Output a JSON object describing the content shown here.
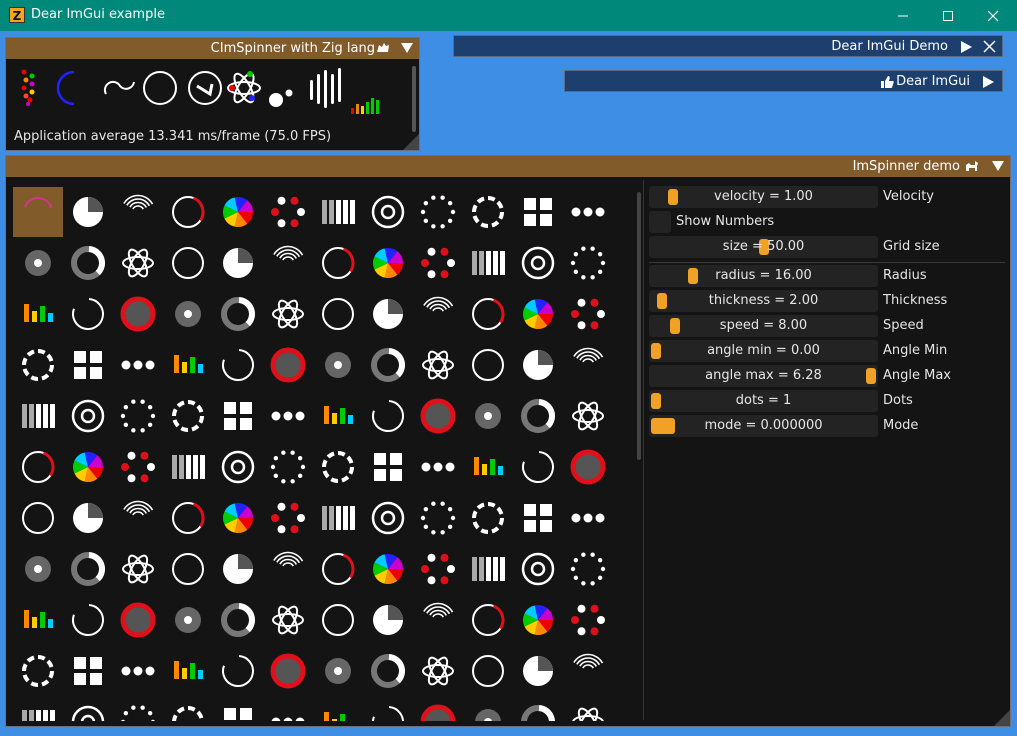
{
  "os_window": {
    "title": "Dear ImGui example",
    "app_icon_letter": "Z",
    "buttons": {
      "minimize": "—",
      "maximize": "☐",
      "close": "✕"
    }
  },
  "zig_window": {
    "title": "CImSpinner with Zig lang",
    "fps_text": "Application average 13.341 ms/frame (75.0 FPS)"
  },
  "demo_collapsed": {
    "title": "Dear ImGui Demo"
  },
  "imgui_collapsed": {
    "title": "Dear ImGui"
  },
  "spinner_window": {
    "title": "ImSpinner demo",
    "controls": [
      {
        "type": "slider",
        "value_text": "velocity = 1.00",
        "label": "Velocity",
        "grab": 0.08
      },
      {
        "type": "checkbox",
        "label": "Show Numbers",
        "checked": false
      },
      {
        "type": "slider",
        "value_text": "size = 50.00",
        "label": "Grid size",
        "grab": 0.5
      },
      {
        "type": "separator"
      },
      {
        "type": "slider",
        "value_text": "radius = 16.00",
        "label": "Radius",
        "grab": 0.17
      },
      {
        "type": "slider",
        "value_text": "thickness = 2.00",
        "label": "Thickness",
        "grab": 0.03
      },
      {
        "type": "slider",
        "value_text": "speed = 8.00",
        "label": "Speed",
        "grab": 0.09
      },
      {
        "type": "slider",
        "value_text": "angle min = 0.00",
        "label": "Angle Min",
        "grab": 0.0
      },
      {
        "type": "slider",
        "value_text": "angle max = 6.28",
        "label": "Angle Max",
        "grab": 1.0
      },
      {
        "type": "slider",
        "value_text": "dots = 1",
        "label": "Dots",
        "grab": 0.0
      },
      {
        "type": "slider",
        "value_text": "mode = 0.000000",
        "label": "Mode",
        "grab": 0.0
      }
    ]
  },
  "colors": {
    "title_bar": "#00897b",
    "window_title": "#825b2a",
    "collapsed_window": "#1c3f6e",
    "background": "#3d8ee4",
    "accent": "#f0a126",
    "spinner_red": "#e0101a"
  }
}
